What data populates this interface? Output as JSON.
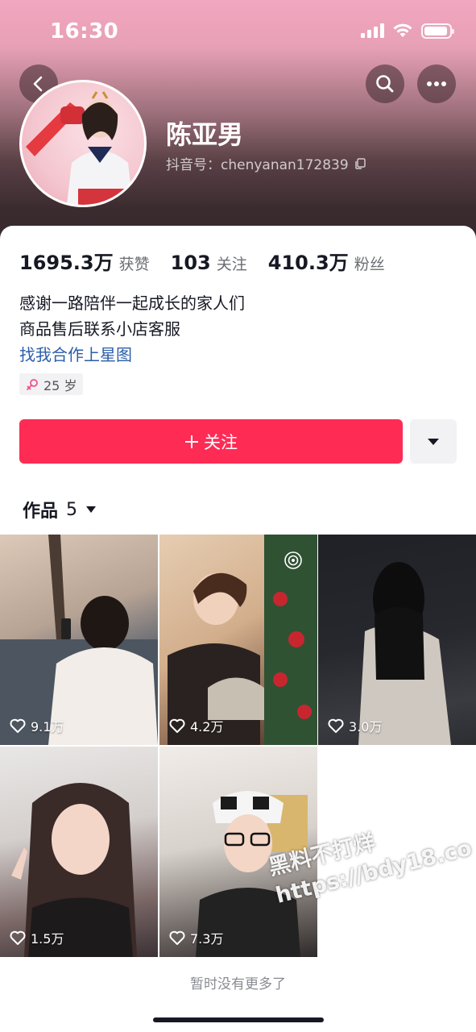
{
  "status_bar": {
    "time": "16:30"
  },
  "profile": {
    "name": "陈亚男",
    "douyin_id": "抖音号：chenyanan172839"
  },
  "stats": [
    {
      "value": "1695.3万",
      "label": "获赞"
    },
    {
      "value": "103",
      "label": "关注"
    },
    {
      "value": "410.3万",
      "label": "粉丝"
    }
  ],
  "bio": {
    "line1": "感谢一路陪伴一起成长的家人们",
    "line2": "商品售后联系小店客服",
    "link": "找我合作上星图"
  },
  "age_tag": "25 岁",
  "follow_button": "关注",
  "works": {
    "label": "作品",
    "count": "5",
    "items": [
      {
        "likes": "9.1万"
      },
      {
        "likes": "4.2万"
      },
      {
        "likes": "3.0万"
      },
      {
        "likes": "1.5万"
      },
      {
        "likes": "7.3万"
      }
    ]
  },
  "footer": {
    "no_more": "暂时没有更多了"
  },
  "watermark": {
    "line1": "黑料不打烊",
    "line2": "https://bdy18.co"
  },
  "colors": {
    "accent": "#fe2c55",
    "link": "#2b5daa"
  },
  "icons": [
    "back-icon",
    "search-icon",
    "more-icon",
    "copy-icon",
    "female-icon",
    "plus-icon",
    "caret-down-icon",
    "heart-icon"
  ]
}
